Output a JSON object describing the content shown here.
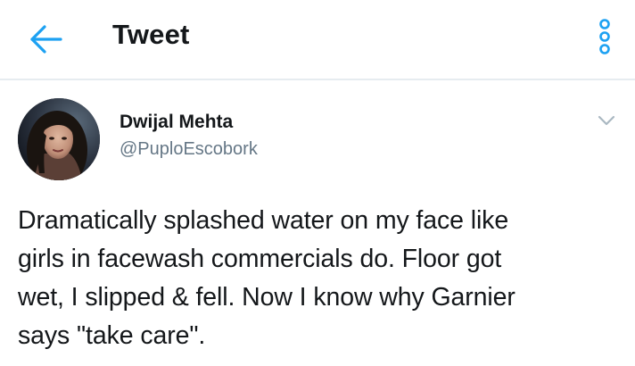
{
  "topbar": {
    "title": "Tweet",
    "back_icon": "arrow-left-icon",
    "overflow_icon": "vertical-dots-icon"
  },
  "tweet": {
    "author": {
      "display_name": "Dwijal Mehta",
      "handle": "@PuploEscobork"
    },
    "caret_icon": "chevron-down-icon",
    "text": "Dramatically splashed water on my face like\ngirls in facewash commercials do. Floor got\nwet, I slipped & fell. Now I know why Garnier\nsays \"take care\"."
  },
  "colors": {
    "accent": "#1da1f2",
    "text_primary": "#14171a",
    "text_secondary": "#657786",
    "divider": "#e6ecf0"
  }
}
